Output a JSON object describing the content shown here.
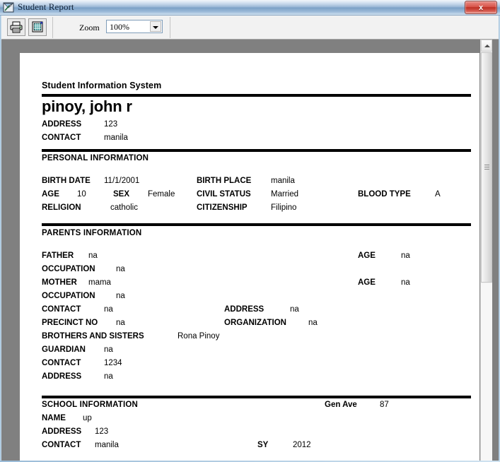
{
  "window": {
    "title": "Student Report",
    "icon": "report-window-icon",
    "close_label": "x"
  },
  "toolbar": {
    "print_icon": "printer-icon",
    "export_icon": "export-document-icon",
    "zoom_label": "Zoom",
    "zoom_value": "100%",
    "zoom_options": [
      "100%"
    ]
  },
  "report": {
    "system_title": "Student Information System",
    "student_name": "pinoy, john r",
    "top": {
      "address_label": "ADDRESS",
      "address_value": "123",
      "contact_label": "CONTACT",
      "contact_value": "manila"
    },
    "personal": {
      "section_title": "PERSONAL INFORMATION",
      "birth_date_label": "BIRTH DATE",
      "birth_date_value": "11/1/2001",
      "birth_place_label": "BIRTH PLACE",
      "birth_place_value": "manila",
      "age_label": "AGE",
      "age_value": "10",
      "sex_label": "SEX",
      "sex_value": "Female",
      "civil_status_label": "CIVIL STATUS",
      "civil_status_value": "Married",
      "blood_type_label": "BLOOD TYPE",
      "blood_type_value": "A",
      "religion_label": "RELIGION",
      "religion_value": "catholic",
      "citizenship_label": "CITIZENSHIP",
      "citizenship_value": "Filipino"
    },
    "parents": {
      "section_title": "PARENTS INFORMATION",
      "father_label": "FATHER",
      "father_value": "na",
      "father_age_label": "AGE",
      "father_age_value": "na",
      "father_occupation_label": "OCCUPATION",
      "father_occupation_value": "na",
      "mother_label": "MOTHER",
      "mother_value": "mama",
      "mother_age_label": "AGE",
      "mother_age_value": "na",
      "mother_occupation_label": "OCCUPATION",
      "mother_occupation_value": "na",
      "contact_label": "CONTACT",
      "contact_value": "na",
      "address_label": "ADDRESS",
      "address_value": "na",
      "precinct_label": "PRECINCT NO",
      "precinct_value": "na",
      "organization_label": "ORGANIZATION",
      "organization_value": "na",
      "siblings_label": "BROTHERS AND SISTERS",
      "siblings_value": "Rona Pinoy",
      "guardian_label": "GUARDIAN",
      "guardian_value": "na",
      "guardian_contact_label": "CONTACT",
      "guardian_contact_value": "1234",
      "guardian_address_label": "ADDRESS",
      "guardian_address_value": "na"
    },
    "school": {
      "section_title": "SCHOOL INFORMATION",
      "extra_label": "Gen Ave",
      "extra_value": "87",
      "name_label": "NAME",
      "name_value": "up",
      "address_label": "ADDRESS",
      "address_value": "123",
      "contact_label": "CONTACT",
      "contact_value": "manila",
      "sy_label": "SY",
      "sy_value": "2012"
    }
  }
}
